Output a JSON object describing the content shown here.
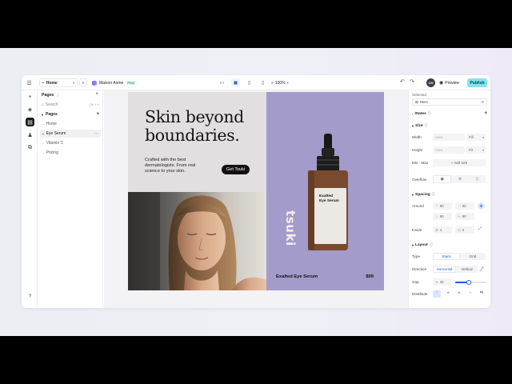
{
  "topbar": {
    "page_selector": "Home",
    "site_name": "Maison Aome",
    "plan_badge": "PRO",
    "zoom": "100%",
    "avatar_initials": "CH",
    "preview_label": "Preview",
    "publish_label": "Publish"
  },
  "pages_panel": {
    "title": "Pages",
    "search_placeholder": "Search",
    "search_shortcut": "Ctrl + K",
    "group_label": "Pages",
    "items": [
      {
        "label": "Home"
      },
      {
        "label": "Eye Serum"
      },
      {
        "label": "Vitamin C"
      },
      {
        "label": "Pricing"
      }
    ]
  },
  "hero": {
    "headline_line1": "Skin beyond",
    "headline_line2": "boundaries.",
    "subtext": "Crafted with the best dermatologists. From real science to your skin.",
    "cta_label": "Get Tsuki",
    "bottle_brand": "tsuki",
    "bottle_label_line1": "Exalted",
    "bottle_label_line2": "Eye Serum",
    "product_name": "Exalted Eye Serum",
    "price": "$99",
    "bg_left": "#e3dfe0",
    "bg_right": "#a39bc9"
  },
  "inspector": {
    "selected_title": "Selected",
    "selected_item": "Hero",
    "states_label": "States",
    "size_label": "Size",
    "width_label": "Width",
    "width_value": "Auto",
    "width_mode": "Fill",
    "height_label": "Height",
    "height_value": "Auto",
    "height_mode": "Fit",
    "minmax_label": "Min · Max",
    "add_size_label": "+ Add size",
    "overflow_label": "Overflow",
    "spacing_label": "Spacing",
    "around_label": "Around",
    "around_values": [
      "80",
      "80",
      "80",
      "80"
    ],
    "inside_label": "Inside",
    "inside_values": [
      "4",
      "0"
    ],
    "layout_label": "Layout",
    "type_label": "Type",
    "type_stack": "Stack",
    "type_grid": "Grid",
    "direction_label": "Direction",
    "direction_horizontal": "Horizontal",
    "direction_vertical": "Vertical",
    "gap_label": "Gap",
    "gap_value": "40",
    "gap_fraction": 0.45,
    "distribute_label": "Distribute"
  },
  "colors": {
    "accent": "#1e5bd8",
    "publish": "#7fe3f3",
    "lavender": "#a39bc9"
  }
}
